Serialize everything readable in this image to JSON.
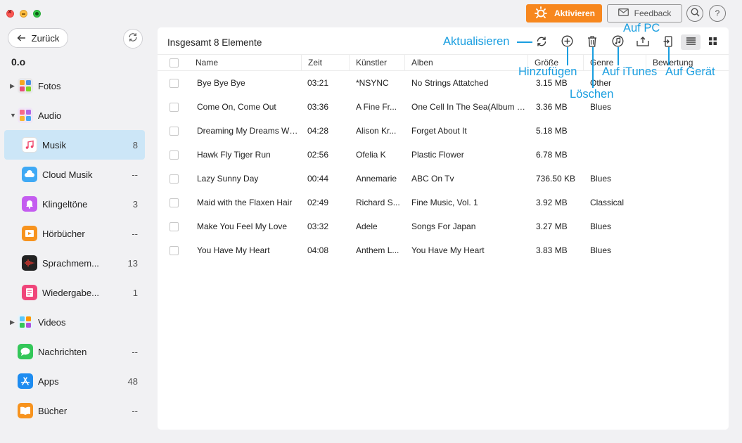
{
  "header": {
    "activate_label": "Aktivieren",
    "feedback_label": "Feedback",
    "help_label": "?"
  },
  "nav": {
    "back_label": "Zurück",
    "device_name": "0.o"
  },
  "sidebar": {
    "items": [
      {
        "label": "Fotos",
        "count": "",
        "icon": "photos-icon",
        "expandable": true,
        "expanded": false
      },
      {
        "label": "Audio",
        "count": "",
        "icon": "audio-icon",
        "expandable": true,
        "expanded": true
      },
      {
        "label": "Musik",
        "count": "8",
        "icon": "music-icon",
        "selected": true
      },
      {
        "label": "Cloud Musik",
        "count": "--",
        "icon": "cloud-music-icon"
      },
      {
        "label": "Klingeltöne",
        "count": "3",
        "icon": "ringtone-icon"
      },
      {
        "label": "Hörbücher",
        "count": "--",
        "icon": "audiobook-icon"
      },
      {
        "label": "Sprachmem...",
        "count": "13",
        "icon": "voice-memo-icon"
      },
      {
        "label": "Wiedergabe...",
        "count": "1",
        "icon": "playlist-icon"
      },
      {
        "label": "Videos",
        "count": "",
        "icon": "videos-icon",
        "expandable": true,
        "expanded": false
      },
      {
        "label": "Nachrichten",
        "count": "--",
        "icon": "messages-icon"
      },
      {
        "label": "Apps",
        "count": "48",
        "icon": "apps-icon"
      },
      {
        "label": "Bücher",
        "count": "--",
        "icon": "books-icon"
      }
    ]
  },
  "main": {
    "title": "Insgesamt 8 Elemente",
    "columns": [
      "Name",
      "Zeit",
      "Künstler",
      "Alben",
      "Größe",
      "Genre",
      "Bewertung"
    ],
    "rows": [
      {
        "name": "Bye Bye Bye",
        "time": "03:21",
        "artist": "*NSYNC",
        "album": "No Strings Attatched",
        "size": "3.15 MB",
        "genre": "Other"
      },
      {
        "name": "Come On, Come Out",
        "time": "03:36",
        "artist": "A Fine Fr...",
        "album": "One Cell In The Sea(Album Ver...",
        "size": "3.36 MB",
        "genre": "Blues"
      },
      {
        "name": "Dreaming My Dreams Wit...",
        "time": "04:28",
        "artist": "Alison Kr...",
        "album": "Forget About It",
        "size": "5.18 MB",
        "genre": ""
      },
      {
        "name": "Hawk Fly Tiger Run",
        "time": "02:56",
        "artist": "Ofelia K",
        "album": "Plastic Flower",
        "size": "6.78 MB",
        "genre": ""
      },
      {
        "name": "Lazy Sunny Day",
        "time": "00:44",
        "artist": "Annemarie",
        "album": "ABC On Tv",
        "size": "736.50 KB",
        "genre": "Blues"
      },
      {
        "name": "Maid with the Flaxen Hair",
        "time": "02:49",
        "artist": "Richard S...",
        "album": "Fine Music, Vol. 1",
        "size": "3.92 MB",
        "genre": "Classical"
      },
      {
        "name": "Make You Feel My Love",
        "time": "03:32",
        "artist": "Adele",
        "album": "Songs For Japan",
        "size": "3.27 MB",
        "genre": "Blues"
      },
      {
        "name": "You Have My Heart",
        "time": "04:08",
        "artist": "Anthem L...",
        "album": "You Have My Heart",
        "size": "3.83 MB",
        "genre": "Blues"
      }
    ]
  },
  "annotations": {
    "refresh": "Aktualisieren",
    "add": "Hinzufügen",
    "delete": "Löschen",
    "to_pc": "Auf PC",
    "to_itunes": "Auf iTunes",
    "to_device": "Auf Gerät"
  },
  "colors": {
    "accent": "#f7871e",
    "annotation": "#199ee0",
    "selected_bg": "#cce6f7"
  }
}
